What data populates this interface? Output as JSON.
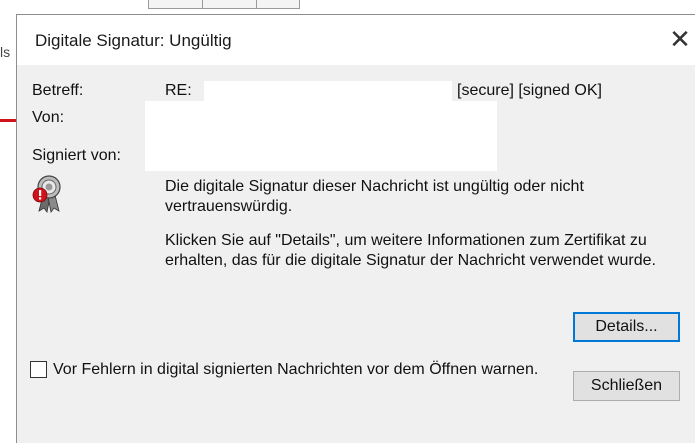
{
  "dialog": {
    "title": "Digitale Signatur: Ungültig",
    "close_glyph": "✕",
    "fields": {
      "subject_label": "Betreff:",
      "subject_prefix": "RE:",
      "subject_suffix": "[secure] [signed OK]",
      "from_label": "Von:",
      "signed_by_label": "Signiert von:"
    },
    "message_line1": "Die digitale Signatur dieser Nachricht ist ungültig oder nicht vertrauenswürdig.",
    "message_line2": "Klicken Sie auf \"Details\", um weitere Informationen zum Zertifikat zu erhalten, das für die digitale Signatur der Nachricht verwendet wurde.",
    "details_button": "Details...",
    "warn_checkbox_label": "Vor Fehlern in digital signierten Nachrichten vor dem Öffnen warnen.",
    "warn_checkbox_checked": false,
    "close_button": "Schließen"
  },
  "background": {
    "left_fragment": "ls a"
  },
  "colors": {
    "dialog_bg": "#f0f0f0",
    "accent_border": "#0078d7",
    "warning_red": "#d0131b"
  },
  "icons": {
    "certificate": "certificate-warning-icon",
    "close": "close-icon"
  }
}
